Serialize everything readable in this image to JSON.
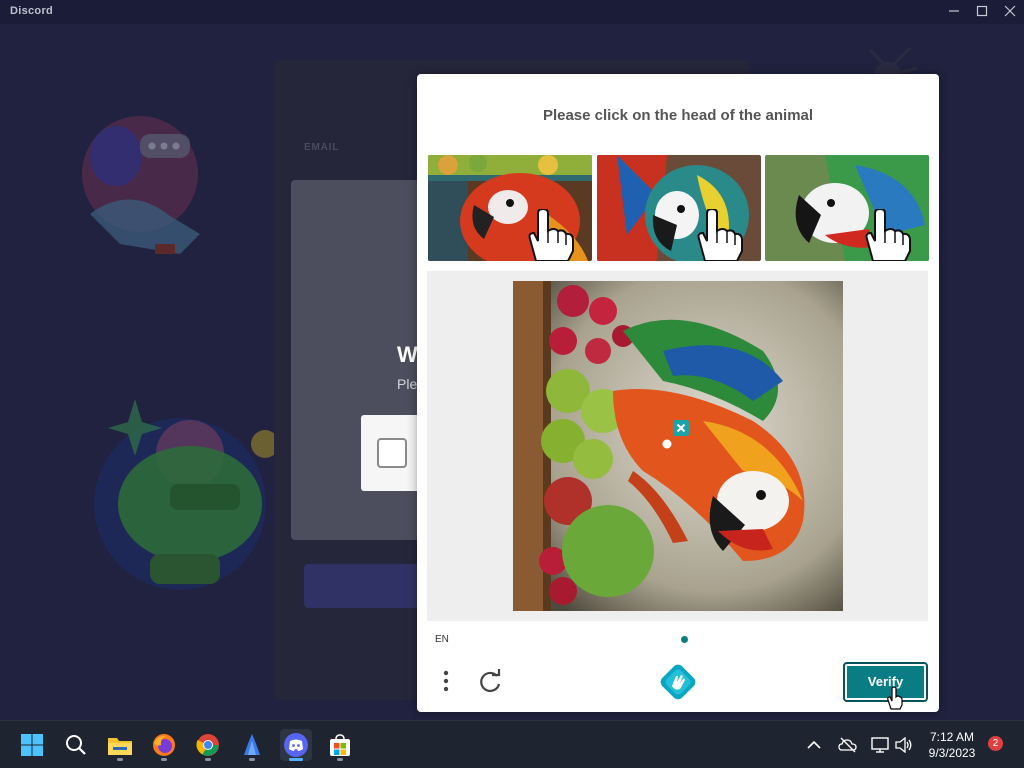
{
  "window": {
    "app_name": "Discord",
    "minimize_icon": "minimize-icon",
    "maximize_icon": "maximize-icon",
    "close_icon": "close-icon"
  },
  "login": {
    "email_label": "EMAIL",
    "dialog_heading": "W",
    "dialog_subtext": "Ple"
  },
  "captcha": {
    "prompt": "Please click on the head of the animal",
    "example_count_label": "",
    "language": "EN",
    "verify_label": "Verify",
    "menu_icon": "more-vertical-icon",
    "refresh_icon": "refresh-icon",
    "brand_icon": "hcaptcha-logo-icon",
    "marker_close_icon": "close-icon",
    "accent_color": "#0a7d84"
  },
  "taskbar": {
    "apps": [
      {
        "name": "start",
        "icon": "windows-start-icon"
      },
      {
        "name": "search",
        "icon": "search-icon"
      },
      {
        "name": "file-explorer",
        "icon": "folder-icon"
      },
      {
        "name": "firefox",
        "icon": "firefox-icon"
      },
      {
        "name": "chrome",
        "icon": "chrome-icon"
      },
      {
        "name": "app-blue",
        "icon": "shark-icon"
      },
      {
        "name": "discord",
        "icon": "discord-icon"
      },
      {
        "name": "store",
        "icon": "store-icon"
      }
    ],
    "tray_icons": [
      "chevron-up-icon",
      "cloud-off-icon",
      "network-icon",
      "volume-icon"
    ],
    "time": "7:12 AM",
    "date": "9/3/2023",
    "notification_count": "2"
  }
}
